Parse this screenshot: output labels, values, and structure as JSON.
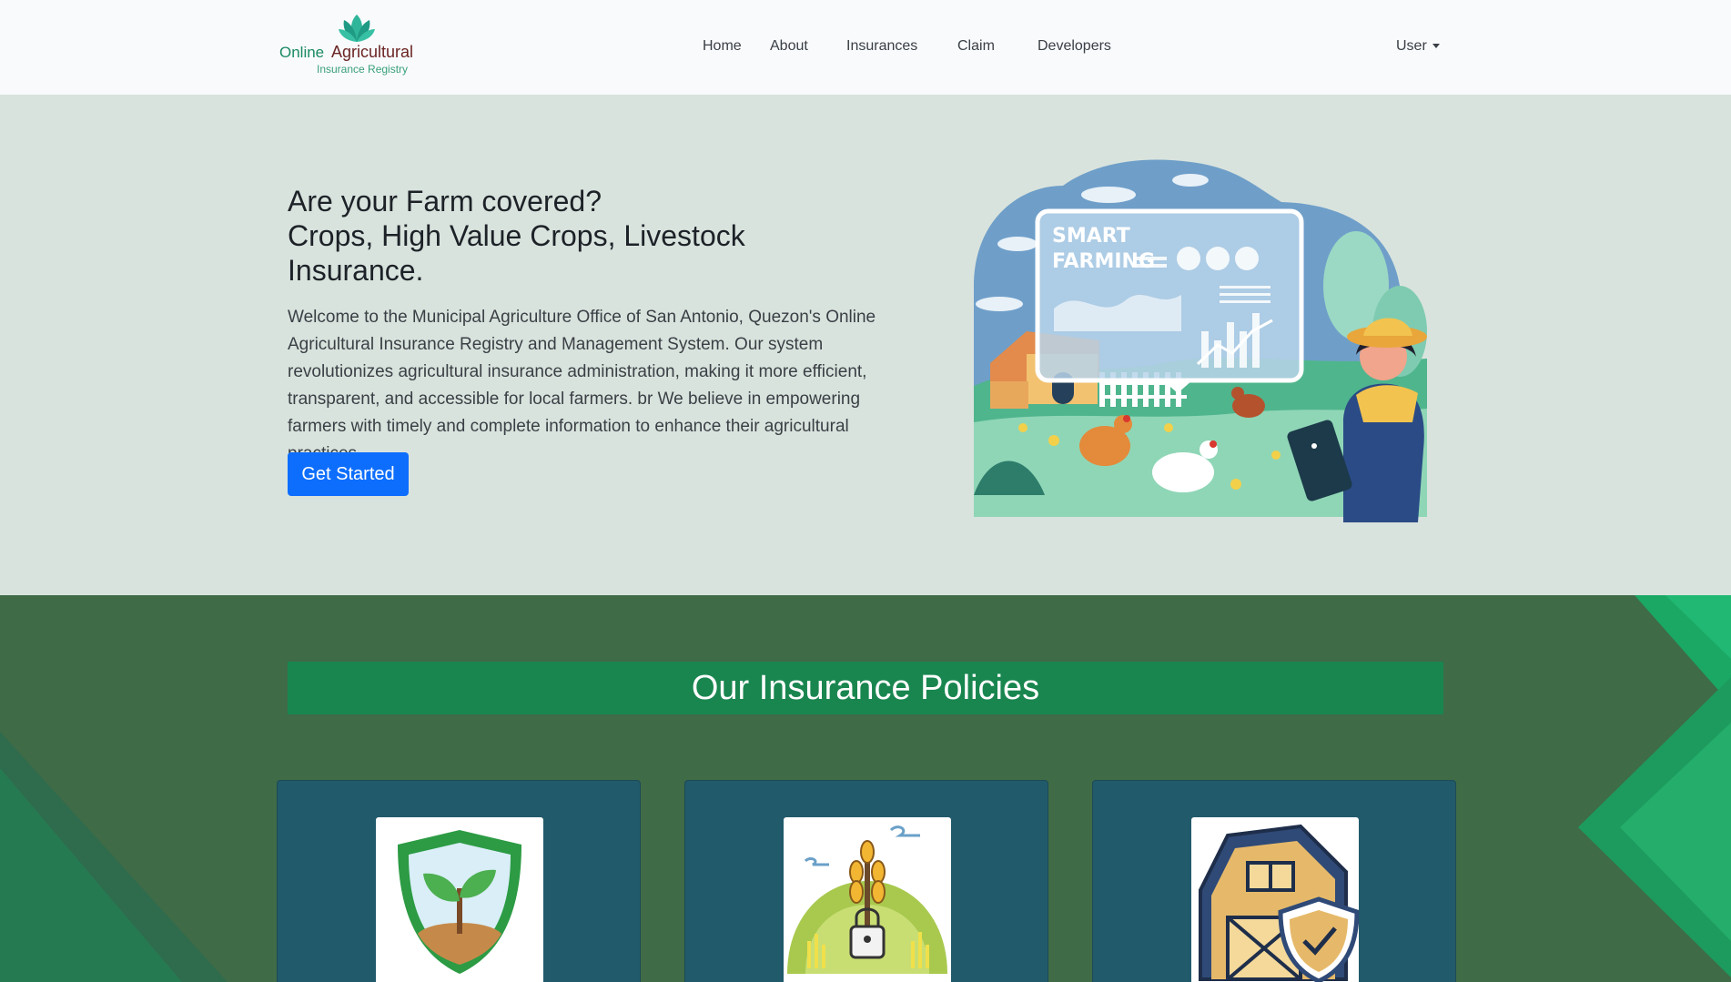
{
  "brand": {
    "word1": "Online",
    "word2": "Agricultural",
    "tagline": "Insurance Registry"
  },
  "nav": {
    "home": "Home",
    "about": "About",
    "insurances": "Insurances",
    "claim": "Claim",
    "developers": "Developers",
    "user": "User"
  },
  "hero": {
    "title_line1": "Are your Farm covered?",
    "title_line2": "Crops, High Value Crops, Livestock Insurance.",
    "description": "Welcome to the Municipal Agriculture Office of San Antonio, Quezon's Online Agricultural Insurance Registry and Management System. Our system revolutionizes agricultural insurance administration, making it more efficient, transparent, and accessible for local farmers. br We believe in empowering farmers with timely and complete information to enhance their agricultural practices.",
    "cta": "Get Started",
    "illustration_text1": "SMART",
    "illustration_text2": "FARMING"
  },
  "policies": {
    "title": "Our Insurance Policies",
    "cards": [
      {
        "icon": "crop-shield-icon"
      },
      {
        "icon": "high-value-crop-lock-icon"
      },
      {
        "icon": "livestock-barn-shield-icon"
      }
    ]
  },
  "colors": {
    "nav_bg": "#f8fafc",
    "hero_bg": "#d9e3dd",
    "cta_blue": "#0d6efd",
    "policies_bg": "#3f6b47",
    "title_banner": "#19864f",
    "card_bg": "#215a6b",
    "brand_green": "#1b8a63",
    "brand_maroon": "#6b2424"
  }
}
